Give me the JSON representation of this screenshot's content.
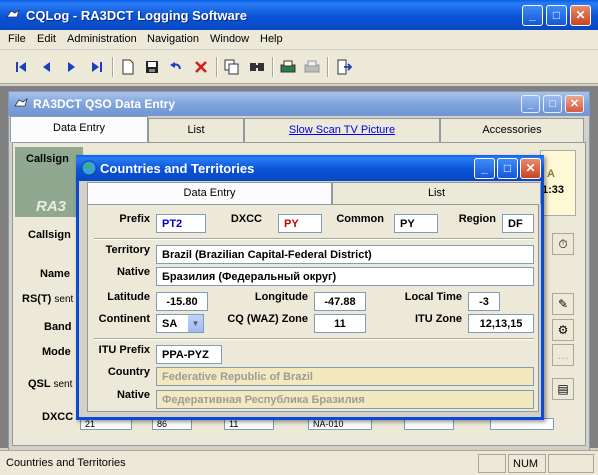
{
  "app": {
    "title": "CQLog - RA3DCT Logging Software"
  },
  "menu": [
    "File",
    "Edit",
    "Administration",
    "Navigation",
    "Window",
    "Help"
  ],
  "toolbar_icons": [
    "first-record-icon",
    "prev-record-icon",
    "next-record-icon",
    "last-record-icon",
    "new-icon",
    "save-icon",
    "undo-icon",
    "delete-icon",
    "copy-icon",
    "find-icon",
    "print-setup-icon",
    "print-icon",
    "exit-icon"
  ],
  "child": {
    "title": "RA3DCT QSO Data Entry",
    "tabs": [
      "Data Entry",
      "List",
      "Slow Scan TV Picture",
      "Accessories"
    ],
    "bg_labels": [
      "Callsign",
      "Callsign",
      "Name",
      "RS(T)",
      "sent",
      "Band",
      "Mode",
      "QSL",
      "sent",
      "DXCC"
    ],
    "bg_fragments": {
      "watermark": "RA3",
      "right_a": "A",
      "right_time": "1:33",
      "dxcc_cells": [
        "21",
        "86",
        "11",
        "NA-010"
      ]
    }
  },
  "dialog": {
    "title": "Countries and Territories",
    "tabs": [
      "Data Entry",
      "List"
    ],
    "labels": {
      "prefix": "Prefix",
      "dxcc": "DXCC",
      "common": "Common",
      "region": "Region",
      "territory": "Territory",
      "native": "Native",
      "latitude": "Latitude",
      "longitude": "Longitude",
      "local_time": "Local Time",
      "continent": "Continent",
      "cq_zone": "CQ (WAZ) Zone",
      "itu_zone": "ITU Zone",
      "itu_prefix": "ITU Prefix",
      "country": "Country",
      "country_native": "Native"
    },
    "values": {
      "prefix": "PT2",
      "dxcc": "PY",
      "common": "PY",
      "region": "DF",
      "territory": "Brazil (Brazilian Capital-Federal District)",
      "native": "Бразилия (Федеральный округ)",
      "latitude": "-15.80",
      "longitude": "-47.88",
      "local_time": "-3",
      "continent": "SA",
      "cq_zone": "11",
      "itu_zone": "12,13,15",
      "itu_prefix": "PPA-PYZ",
      "country": "Federative Republic of Brazil",
      "country_native": "Федеративная Республика Бразилия"
    }
  },
  "statusbar": {
    "text": "Countries and Territories",
    "num": "NUM"
  }
}
